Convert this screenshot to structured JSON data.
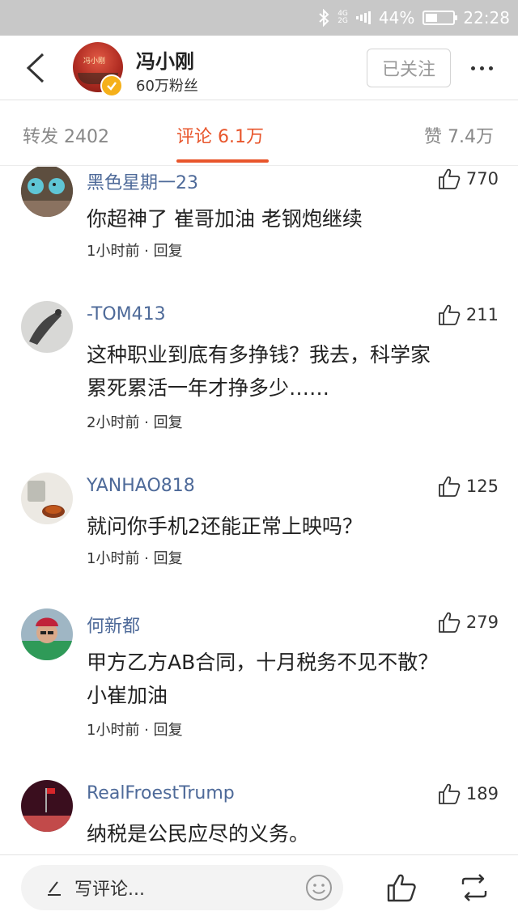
{
  "status_bar": {
    "network_top": "4G",
    "network_bottom": "2G",
    "battery": "44%",
    "battery_level": 0.44,
    "time": "22:28"
  },
  "header": {
    "avatar_text": "冯小刚",
    "name": "冯小刚",
    "fans": "60万粉丝",
    "follow_label": "已关注"
  },
  "tabs": {
    "repost": "转发 2402",
    "comments": "评论 6.1万",
    "likes": "赞 7.4万"
  },
  "comments": [
    {
      "user": "黑色星期一23",
      "likes": "770",
      "lines": [
        "你超神了 崔哥加油 老钢炮继续"
      ],
      "time": "1小时前",
      "reply": "回复"
    },
    {
      "user": "-TOM413",
      "likes": "211",
      "lines": [
        "这种职业到底有多挣钱？我去，科学家",
        "累死累活一年才挣多少……"
      ],
      "time": "2小时前",
      "reply": "回复"
    },
    {
      "user": "YANHAO818",
      "likes": "125",
      "lines": [
        "就问你手机2还能正常上映吗？"
      ],
      "time": "1小时前",
      "reply": "回复"
    },
    {
      "user": "何新都",
      "likes": "279",
      "lines": [
        "甲方乙方AB合同，十月税务不见不散？",
        "小崔加油"
      ],
      "time": "1小时前",
      "reply": "回复"
    },
    {
      "user": "RealFroestTrump",
      "likes": "189",
      "lines": [
        "纳税是公民应尽的义务。"
      ],
      "time": "",
      "reply": ""
    }
  ],
  "bottom_bar": {
    "placeholder": "写评论..."
  },
  "colors": {
    "accent": "#e8552b",
    "username": "#4e6a99",
    "status_bar": "#c8c8c8"
  },
  "icons": [
    "back-arrow-icon",
    "verified-icon",
    "more-icon",
    "thumb-up-icon",
    "pen-icon",
    "emoji-icon",
    "repost-icon"
  ]
}
